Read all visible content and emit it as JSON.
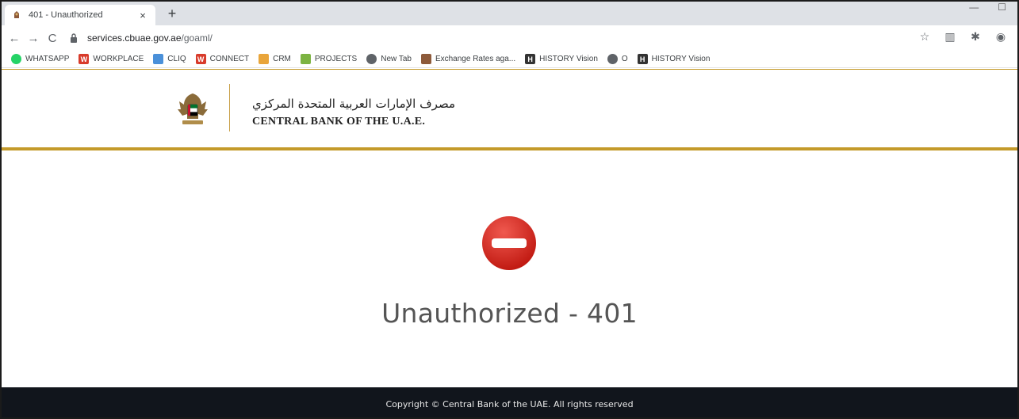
{
  "browser": {
    "tab": {
      "title": "401 - Unauthorized",
      "close_label": "×"
    },
    "new_tab_label": "+",
    "window_controls": {
      "minimize": "—",
      "maximize": "☐"
    },
    "nav": {
      "back": "←",
      "forward": "→",
      "reload": "C"
    },
    "url": {
      "host": "services.cbuae.gov.ae",
      "path": "/goaml/"
    },
    "toolbar_icons": {
      "star": "☆",
      "extension": "▥",
      "puzzle": "✱",
      "profile": "◉"
    }
  },
  "bookmarks": [
    {
      "label": "WHATSAPP",
      "icon": "whatsapp-icon",
      "color": "#25d366",
      "glyph": ""
    },
    {
      "label": "WORKPLACE",
      "icon": "workplace-icon",
      "color": "#d83b2b",
      "glyph": "W"
    },
    {
      "label": "CLIQ",
      "icon": "cliq-icon",
      "color": "#4a90d9",
      "glyph": ""
    },
    {
      "label": "CONNECT",
      "icon": "connect-icon",
      "color": "#d83b2b",
      "glyph": "W"
    },
    {
      "label": "CRM",
      "icon": "crm-icon",
      "color": "#e9a53a",
      "glyph": ""
    },
    {
      "label": "PROJECTS",
      "icon": "projects-icon",
      "color": "#7cb342",
      "glyph": ""
    },
    {
      "label": "New Tab",
      "icon": "globe-icon",
      "color": "#5f6368",
      "glyph": ""
    },
    {
      "label": "Exchange Rates aga...",
      "icon": "cbuae-favicon-icon",
      "color": "#8d5a3a",
      "glyph": ""
    },
    {
      "label": "HISTORY Vision",
      "icon": "history-icon",
      "color": "#333333",
      "glyph": "H"
    },
    {
      "label": "O",
      "icon": "globe-icon",
      "color": "#5f6368",
      "glyph": ""
    },
    {
      "label": "HISTORY Vision",
      "icon": "history-icon",
      "color": "#333333",
      "glyph": "H"
    }
  ],
  "header": {
    "bank_name_ar": "مصرف الإمارات العربية المتحدة المركزي",
    "bank_name_en": "CENTRAL BANK OF THE U.A.E."
  },
  "error": {
    "icon": "stop-icon",
    "title": "Unauthorized - 401"
  },
  "footer": {
    "copyright": "Copyright © Central Bank of the UAE. All rights reserved"
  },
  "colors": {
    "gold": "#c49a2a",
    "footer_bg": "#11151c",
    "stop_red": "#d7261e"
  }
}
